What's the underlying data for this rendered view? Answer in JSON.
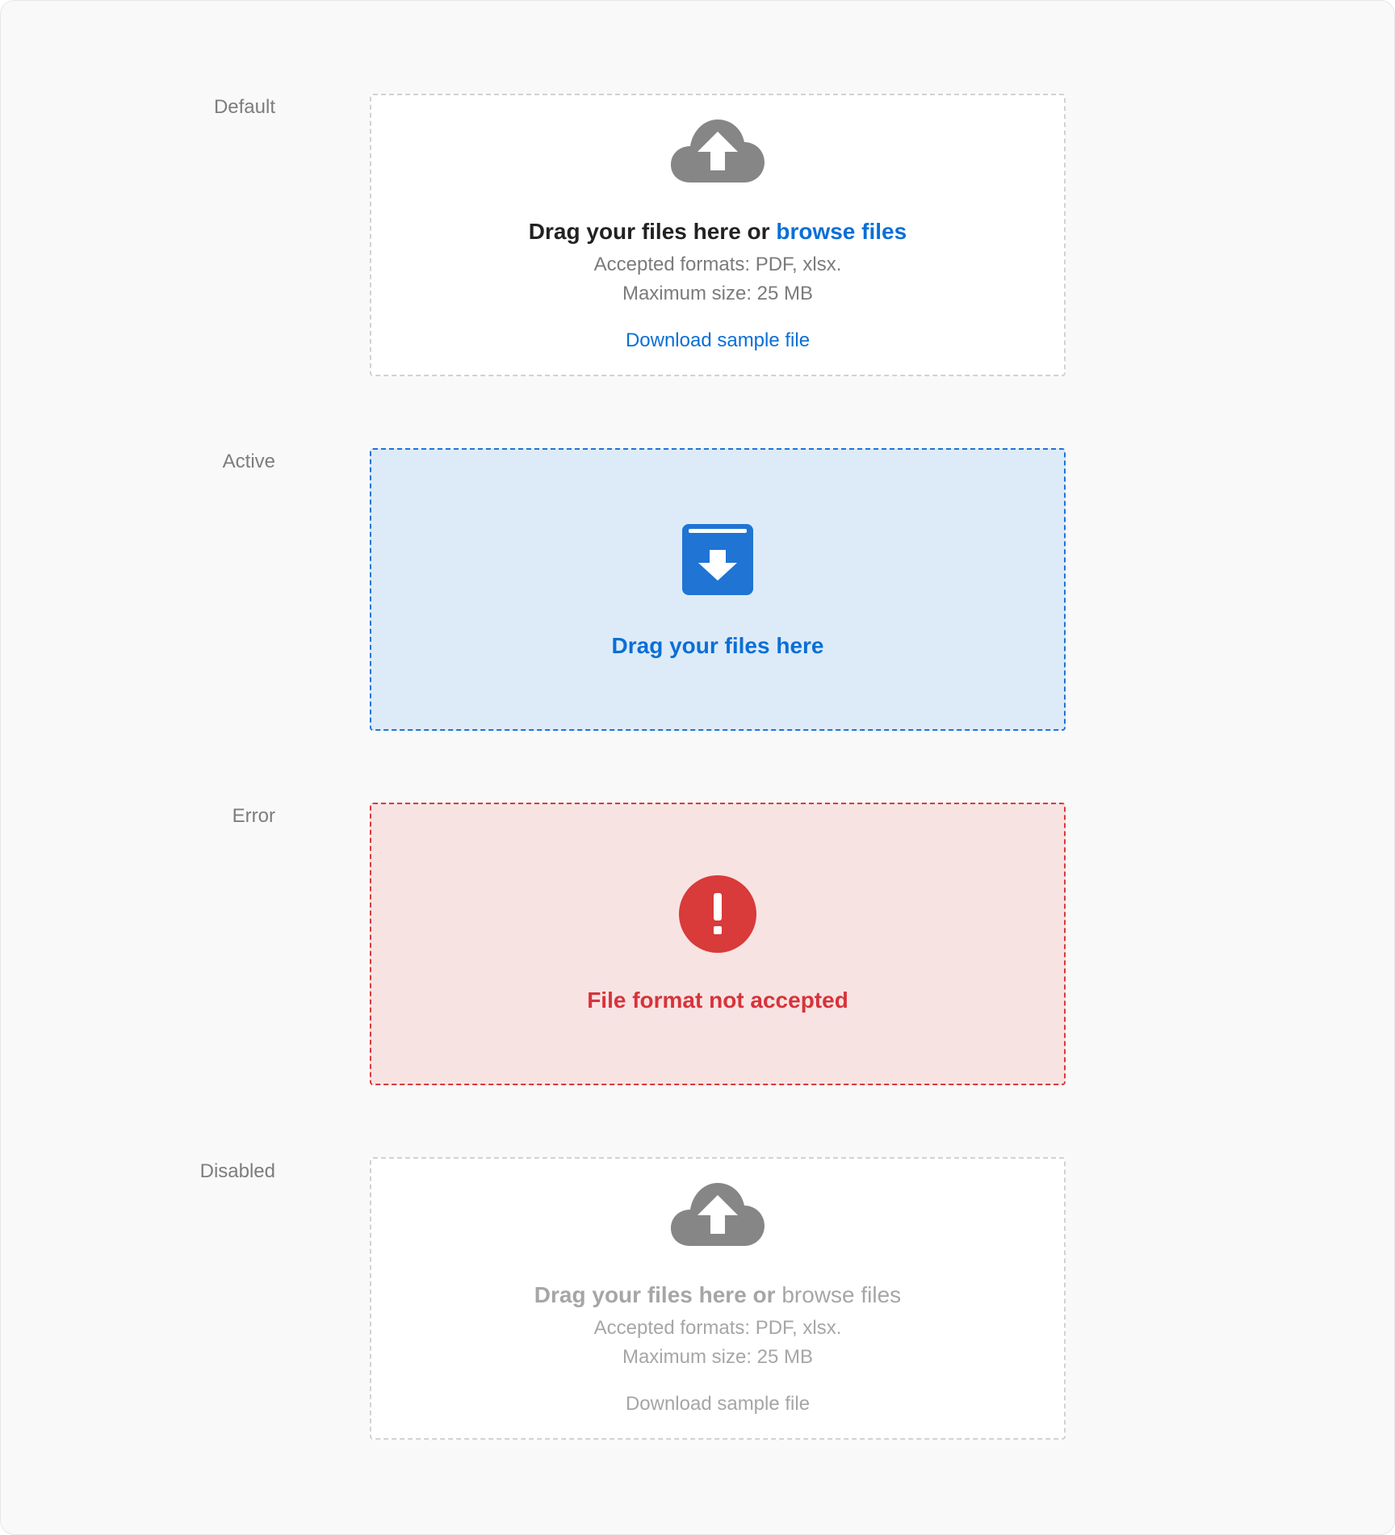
{
  "states": {
    "default": {
      "label": "Default",
      "headline_prefix": "Drag your files here or ",
      "browse_link": "browse files",
      "formats": "Accepted formats: PDF, xlsx.",
      "max_size": "Maximum size: 25 MB",
      "download_link": "Download sample file",
      "icon": "cloud-upload-icon"
    },
    "active": {
      "label": "Active",
      "message": "Drag your files here",
      "icon": "archive-download-icon"
    },
    "error": {
      "label": "Error",
      "message": "File format not accepted",
      "icon": "error-alert-icon"
    },
    "disabled": {
      "label": "Disabled",
      "headline_prefix": "Drag your files here or ",
      "browse_link": "browse files",
      "formats": "Accepted formats: PDF, xlsx.",
      "max_size": "Maximum size: 25 MB",
      "download_link": "Download sample file",
      "icon": "cloud-upload-icon"
    }
  },
  "colors": {
    "page_background": "#f9f9f9",
    "link_blue": "#0a6fd6",
    "active_background": "#ddebf8",
    "active_border": "#1f74d4",
    "error_background": "#f8e3e3",
    "error_red": "#d6343a",
    "icon_gray": "#868686",
    "disabled_text": "#a6a6a6"
  }
}
